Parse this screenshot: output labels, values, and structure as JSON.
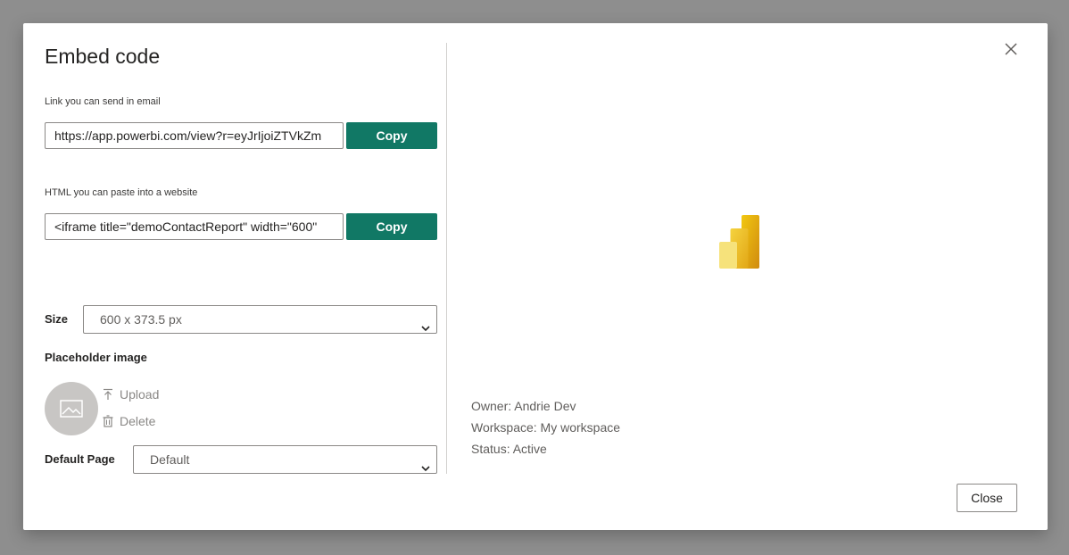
{
  "dialog": {
    "title": "Embed code",
    "close_icon": "close-icon"
  },
  "link_section": {
    "label": "Link you can send in email",
    "value": "https://app.powerbi.com/view?r=eyJrIjoiZTVkZm",
    "copy_label": "Copy"
  },
  "html_section": {
    "label": "HTML you can paste into a website",
    "value": "<iframe title=\"demoContactReport\" width=\"600\"",
    "copy_label": "Copy"
  },
  "size": {
    "label": "Size",
    "selected": "600 x 373.5 px"
  },
  "placeholder_image": {
    "label": "Placeholder image",
    "upload_label": "Upload",
    "delete_label": "Delete"
  },
  "default_page": {
    "label": "Default Page",
    "selected": "Default"
  },
  "report_info": {
    "owner": "Owner: Andrie Dev",
    "workspace": "Workspace: My workspace",
    "status": "Status: Active"
  },
  "footer": {
    "close_label": "Close"
  },
  "colors": {
    "primary_button": "#117865",
    "logo_light": "#f2c811",
    "logo_dark": "#e8a317"
  }
}
